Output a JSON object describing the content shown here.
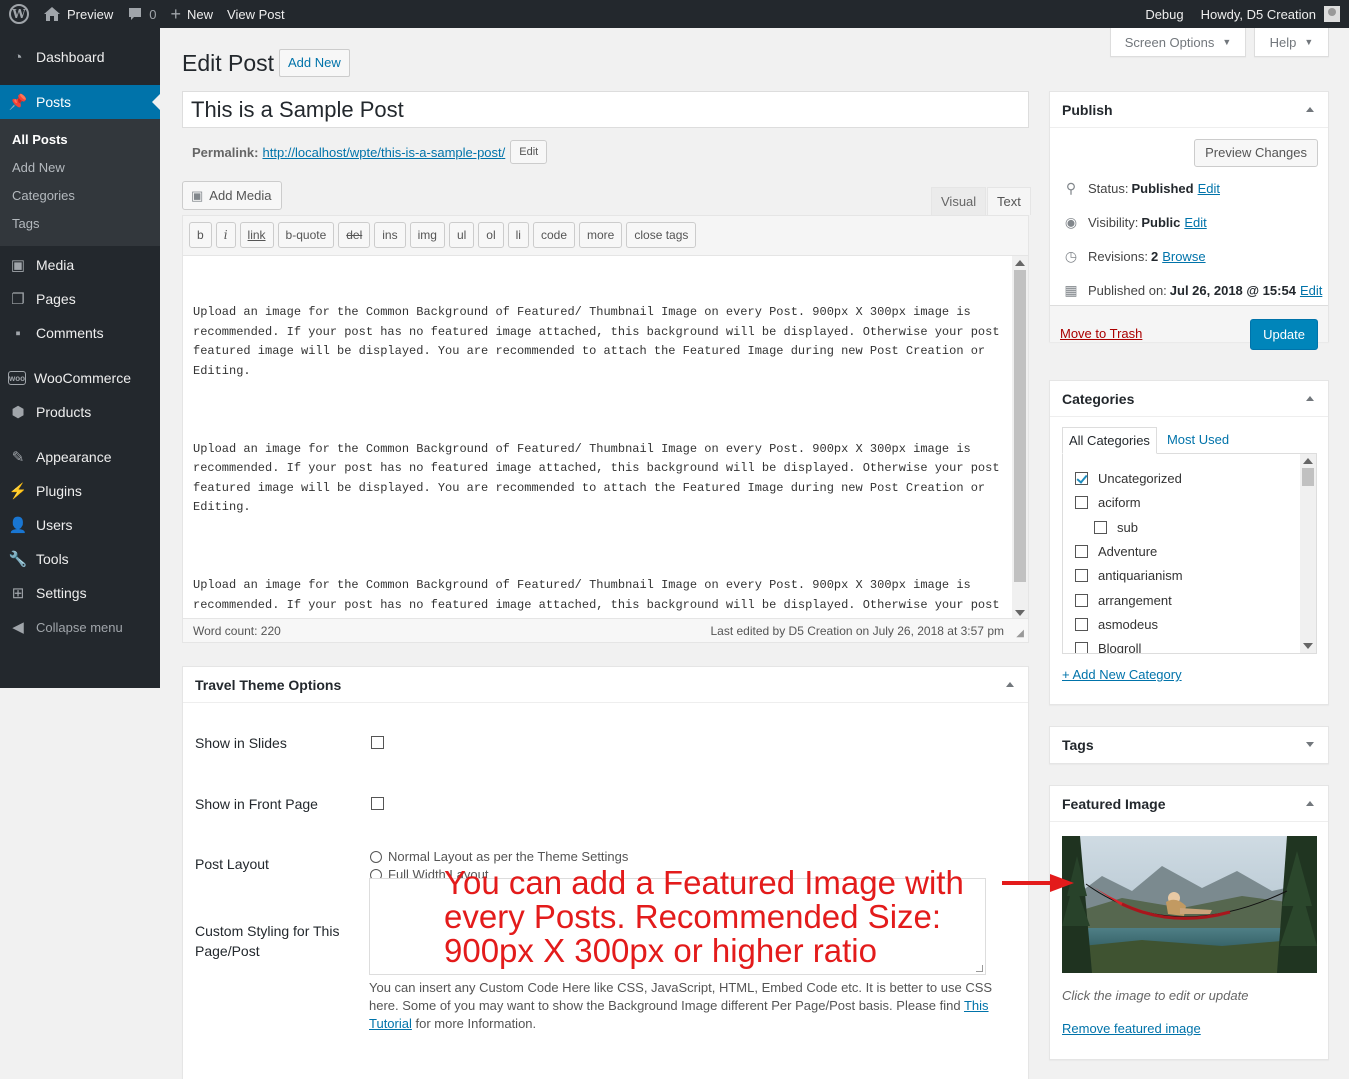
{
  "adminbar": {
    "preview": "Preview",
    "comments_count": "0",
    "new": "New",
    "view_post": "View Post",
    "debug": "Debug",
    "howdy": "Howdy, D5 Creation"
  },
  "sidebar": {
    "dashboard": "Dashboard",
    "posts": "Posts",
    "sub": [
      "All Posts",
      "Add New",
      "Categories",
      "Tags"
    ],
    "media": "Media",
    "pages": "Pages",
    "comments": "Comments",
    "woocommerce": "WooCommerce",
    "products": "Products",
    "appearance": "Appearance",
    "plugins": "Plugins",
    "users": "Users",
    "tools": "Tools",
    "settings": "Settings",
    "collapse": "Collapse menu"
  },
  "header": {
    "title": "Edit Post",
    "add_new": "Add New",
    "screen_options": "Screen Options",
    "help": "Help"
  },
  "post": {
    "title": "This is a Sample Post",
    "permalink_label": "Permalink:",
    "permalink_prefix": "http://localhost/wpte/",
    "permalink_slug": "this-is-a-sample-post",
    "permalink_suffix": "/",
    "edit": "Edit"
  },
  "editor": {
    "add_media": "Add Media",
    "tab_visual": "Visual",
    "tab_text": "Text",
    "quicktags": [
      "b",
      "i",
      "link",
      "b-quote",
      "del",
      "ins",
      "img",
      "ul",
      "ol",
      "li",
      "code",
      "more",
      "close tags"
    ],
    "paragraph": "Upload an image for the Common Background of Featured/ Thumbnail Image on every Post. 900px X 300px image is recommended. If your post has no featured image attached, this background will be displayed. Otherwise your post featured image will be displayed. You are recommended to attach the Featured Image during new Post Creation or Editing.",
    "word_count": "Word count: 220",
    "last_edited": "Last edited by D5 Creation on July 26, 2018 at 3:57 pm"
  },
  "travel": {
    "title": "Travel Theme Options",
    "show_in_slides": "Show in Slides",
    "show_in_front": "Show in Front Page",
    "post_layout": "Post Layout",
    "layout_normal": "Normal Layout as per the Theme Settings",
    "layout_full": "Full Width Layout",
    "custom_styling": "Custom Styling for This Page/Post",
    "help_pre": "You can insert any Custom Code Here like CSS, JavaScript, HTML, Embed Code etc. It is better to use CSS here. Some of you may want to show the Background Image different Per Page/Post basis. Please find ",
    "help_link": "This Tutorial",
    "help_post": " for more Information."
  },
  "publish": {
    "title": "Publish",
    "preview_changes": "Preview Changes",
    "status_label": "Status:",
    "status_value": "Published",
    "visibility_label": "Visibility:",
    "visibility_value": "Public",
    "revisions_label": "Revisions:",
    "revisions_value": "2",
    "browse": "Browse",
    "published_label": "Published on:",
    "published_value": "Jul 26, 2018 @ 15:54",
    "edit": "Edit",
    "trash": "Move to Trash",
    "update": "Update"
  },
  "categories": {
    "title": "Categories",
    "tab_all": "All Categories",
    "tab_most": "Most Used",
    "items": [
      {
        "name": "Uncategorized",
        "checked": true,
        "indent": 0
      },
      {
        "name": "aciform",
        "checked": false,
        "indent": 0
      },
      {
        "name": "sub",
        "checked": false,
        "indent": 1
      },
      {
        "name": "Adventure",
        "checked": false,
        "indent": 0
      },
      {
        "name": "antiquarianism",
        "checked": false,
        "indent": 0
      },
      {
        "name": "arrangement",
        "checked": false,
        "indent": 0
      },
      {
        "name": "asmodeus",
        "checked": false,
        "indent": 0
      },
      {
        "name": "Blogroll",
        "checked": false,
        "indent": 0
      }
    ],
    "add_new": "+ Add New Category"
  },
  "tags": {
    "title": "Tags"
  },
  "featured": {
    "title": "Featured Image",
    "hint": "Click the image to edit or update",
    "remove": "Remove featured image"
  },
  "annotation": {
    "text": "You can add a Featured Image with every Posts. Recommended Size: 900px X 300px or higher ratio",
    "color": "#e31b1b"
  },
  "colors": {
    "adminbar": "#23282d",
    "accent": "#0073aa",
    "primary_button": "#0085ba",
    "trash": "#a00"
  }
}
